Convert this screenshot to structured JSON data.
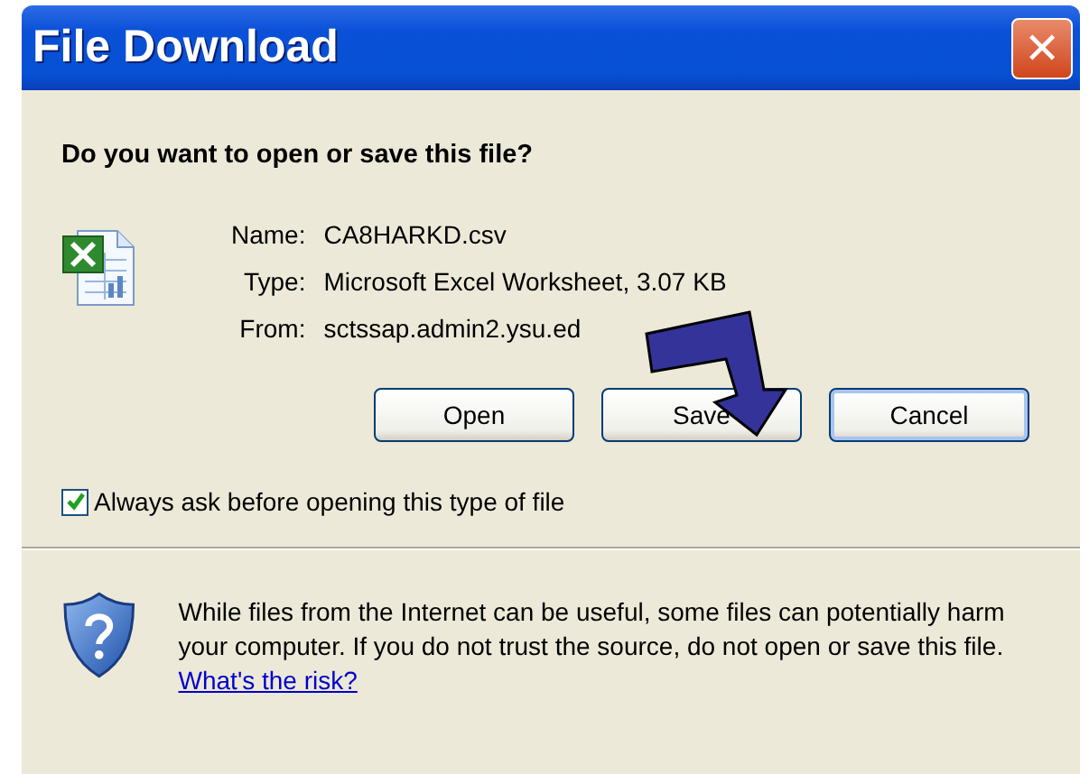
{
  "window": {
    "title": "File Download",
    "close": "✕"
  },
  "question": "Do you want to open or save this file?",
  "fields": [
    {
      "label": "Name:",
      "value": "CA8HARKD.csv"
    },
    {
      "label": "Type:",
      "value": "Microsoft Excel Worksheet, 3.07 KB"
    },
    {
      "label": "From:",
      "value": "sctssap.admin2.ysu.ed"
    }
  ],
  "buttons": [
    {
      "label": "Open",
      "selected": false
    },
    {
      "label": "Save",
      "selected": false
    },
    {
      "label": "Cancel",
      "selected": true
    }
  ],
  "always_ask": {
    "label": "Always ask before opening this type of file",
    "checked": true
  },
  "warning": {
    "text": "While files from the Internet can be useful, some files can potentially harm your computer. If you do not trust the source, do not open or save this file.",
    "link": "What's the risk?"
  }
}
